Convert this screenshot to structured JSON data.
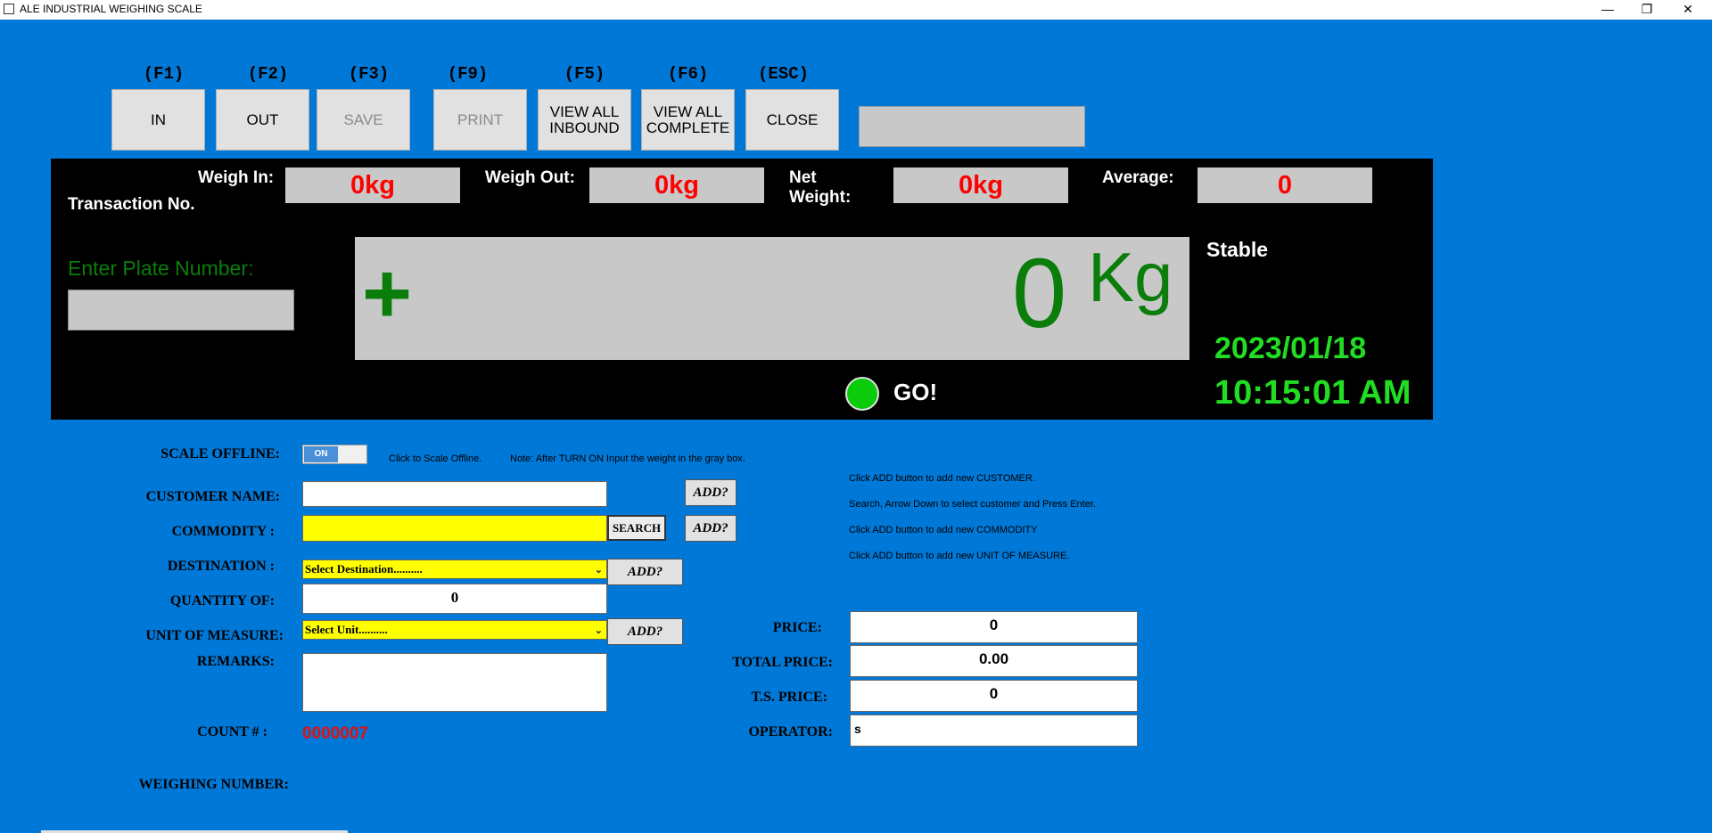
{
  "window": {
    "title": "ALE INDUSTRIAL WEIGHING SCALE",
    "minimize": "—",
    "restore": "❐",
    "close": "✕"
  },
  "toolbar": {
    "buttons": [
      {
        "key": "(F1)",
        "label": "IN"
      },
      {
        "key": "(F2)",
        "label": "OUT"
      },
      {
        "key": "(F3)",
        "label": "SAVE"
      },
      {
        "key": "(F9)",
        "label": "PRINT"
      },
      {
        "key": "(F5)",
        "label": "VIEW ALL\nINBOUND"
      },
      {
        "key": "(F6)",
        "label": "VIEW ALL\nCOMPLETE"
      },
      {
        "key": "(ESC)",
        "label": "CLOSE"
      }
    ]
  },
  "panel": {
    "weigh_in_label": "Weigh In:",
    "weigh_in_value": "0kg",
    "weigh_out_label": "Weigh Out:",
    "weigh_out_value": "0kg",
    "net_weight_label": "Net\nWeight:",
    "net_weight_value": "0kg",
    "average_label": "Average:",
    "average_value": "0",
    "transaction_label": "Transaction No.",
    "plate_label": "Enter Plate Number:",
    "plus": "+",
    "weight_value": "0",
    "weight_unit": "Kg",
    "stable": "Stable",
    "date": "2023/01/18",
    "time": "10:15:01 AM",
    "go": "GO!",
    "colors": {
      "indicator": "#0bcc0b",
      "display_text": "#0b7d0b",
      "clock": "#22dd22",
      "weights": "#ff0000"
    }
  },
  "form": {
    "scale_offline_label": "SCALE OFFLINE:",
    "toggle_label": "ON",
    "scale_offline_hint": "Click to Scale Offline.",
    "note": "Note: After TURN ON Input the weight in the gray box.",
    "customer_label": "CUSTOMER NAME:",
    "customer_value": "",
    "commodity_label": "COMMODITY :",
    "commodity_value": "",
    "search_label": "SEARCH",
    "add_label": "ADD?",
    "destination_label": "DESTINATION :",
    "destination_value": "Select Destination..........",
    "quantity_label": "QUANTITY OF:",
    "quantity_value": "0",
    "unit_label": "UNIT OF MEASURE:",
    "unit_value": "Select Unit..........",
    "remarks_label": "REMARKS:",
    "remarks_value": "",
    "count_label": "COUNT # :",
    "count_value": "0000007",
    "weighing_number_label": "WEIGHING NUMBER:",
    "price_label": "PRICE:",
    "price_value": "0",
    "total_price_label": "TOTAL PRICE:",
    "total_price_value": "0.00",
    "ts_price_label": "T.S. PRICE:",
    "ts_price_value": "0",
    "operator_label": "OPERATOR:",
    "operator_value": "s",
    "hints": [
      "Click ADD button to add new CUSTOMER.",
      "Search, Arrow Down to select customer and Press Enter.",
      "Click ADD button to add new COMMODITY",
      "Click ADD button to add new UNIT OF MEASURE."
    ]
  }
}
